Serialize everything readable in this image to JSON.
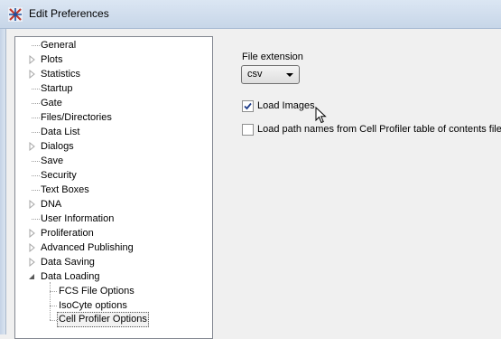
{
  "window": {
    "title": "Edit Preferences"
  },
  "tree": {
    "items": [
      {
        "label": "General",
        "expandable": false
      },
      {
        "label": "Plots",
        "expandable": true
      },
      {
        "label": "Statistics",
        "expandable": true
      },
      {
        "label": "Startup",
        "expandable": false
      },
      {
        "label": "Gate",
        "expandable": false
      },
      {
        "label": "Files/Directories",
        "expandable": false
      },
      {
        "label": "Data List",
        "expandable": false
      },
      {
        "label": "Dialogs",
        "expandable": true
      },
      {
        "label": "Save",
        "expandable": false
      },
      {
        "label": "Security",
        "expandable": false
      },
      {
        "label": "Text Boxes",
        "expandable": false
      },
      {
        "label": "DNA",
        "expandable": true
      },
      {
        "label": "User Information",
        "expandable": false
      },
      {
        "label": "Proliferation",
        "expandable": true
      },
      {
        "label": "Advanced Publishing",
        "expandable": true
      },
      {
        "label": "Data Saving",
        "expandable": true
      },
      {
        "label": "Data Loading",
        "expandable": true,
        "expanded": true
      },
      {
        "label": "FCS File Options",
        "child": true
      },
      {
        "label": "IsoCyte options",
        "child": true
      },
      {
        "label": "Cell Profiler Options",
        "child": true,
        "selected": true
      }
    ]
  },
  "settings": {
    "file_extension_label": "File extension",
    "file_extension_value": "csv",
    "load_images_label": "Load Images",
    "load_images_checked": true,
    "load_path_names_label": "Load path names from Cell Profiler table of contents file",
    "load_path_names_checked": false
  }
}
